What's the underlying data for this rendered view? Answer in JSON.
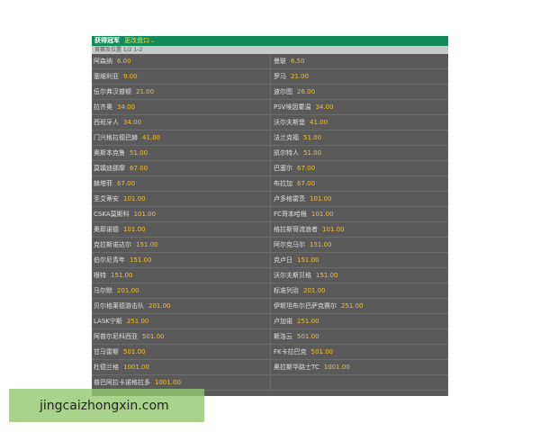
{
  "header": {
    "title": "获得冠军",
    "edit_label": "更改盘口",
    "chevron": "⌄"
  },
  "subheader": {
    "text": "首赛及位置 1/2 1-2"
  },
  "colors": {
    "header_bg": "#138a5c",
    "panel_bg": "#5a5a5a",
    "odds": "#f2c12e",
    "edit": "#ffdd33"
  },
  "rows": [
    [
      {
        "team": "阿森纳",
        "odds": "6.00"
      },
      {
        "team": "曼联",
        "odds": "6.50"
      }
    ],
    [
      {
        "team": "塞维利亚",
        "odds": "9.00"
      },
      {
        "team": "罗马",
        "odds": "21.00"
      }
    ],
    [
      {
        "team": "伍尔弗汉普顿",
        "odds": "21.00"
      },
      {
        "team": "波尔图",
        "odds": "26.00"
      }
    ],
    [
      {
        "team": "拉齐奥",
        "odds": "34.00"
      },
      {
        "team": "PSV埃因霍温",
        "odds": "34.00"
      }
    ],
    [
      {
        "team": "西班牙人",
        "odds": "34.00"
      },
      {
        "team": "沃尔夫斯堡",
        "odds": "41.00"
      }
    ],
    [
      {
        "team": "门兴格拉德巴赫",
        "odds": "41.00"
      },
      {
        "team": "法兰克福",
        "odds": "51.00"
      }
    ],
    [
      {
        "team": "奥斯本克鲁",
        "odds": "51.00"
      },
      {
        "team": "凯尔特人",
        "odds": "51.00"
      }
    ],
    [
      {
        "team": "莫镇迪那摩",
        "odds": "67.00"
      },
      {
        "team": "巴塞尔",
        "odds": "67.00"
      }
    ],
    [
      {
        "team": "赫塔菲",
        "odds": "67.00"
      },
      {
        "team": "布拉加",
        "odds": "67.00"
      }
    ],
    [
      {
        "team": "圣艾蒂安",
        "odds": "101.00"
      },
      {
        "team": "卢多格雷茨",
        "odds": "101.00"
      }
    ],
    [
      {
        "team": "CSKA莫斯科",
        "odds": "101.00"
      },
      {
        "team": "FC哥本哈根",
        "odds": "101.00"
      }
    ],
    [
      {
        "team": "奥耶诺德",
        "odds": "101.00"
      },
      {
        "team": "格拉斯哥流浪者",
        "odds": "101.00"
      }
    ],
    [
      {
        "team": "克拉斯诺达尔",
        "odds": "151.00"
      },
      {
        "team": "阿尔克马尔",
        "odds": "151.00"
      }
    ],
    [
      {
        "team": "伯尔尼青年",
        "odds": "151.00"
      },
      {
        "team": "克卢日",
        "odds": "151.00"
      }
    ],
    [
      {
        "team": "根特",
        "odds": "151.00"
      },
      {
        "team": "沃尔夫斯贝格",
        "odds": "151.00"
      }
    ],
    [
      {
        "team": "马尔默",
        "odds": "201.00"
      },
      {
        "team": "标准列治",
        "odds": "201.00"
      }
    ],
    [
      {
        "team": "贝尔格莱德游击队",
        "odds": "201.00"
      },
      {
        "team": "伊斯坦布尔巴萨克赛尔",
        "odds": "251.00"
      }
    ],
    [
      {
        "team": "LASK宁斯",
        "odds": "251.00"
      },
      {
        "team": "卢加诺",
        "odds": "251.00"
      }
    ],
    [
      {
        "team": "阿普尔尼科西亚",
        "odds": "501.00"
      },
      {
        "team": "斯洛云",
        "odds": "501.00"
      }
    ],
    [
      {
        "team": "甘马雷斯",
        "odds": "501.00"
      },
      {
        "team": "FK卡拉巴克",
        "odds": "501.00"
      }
    ],
    [
      {
        "team": "杜德兰格",
        "odds": "1001.00"
      },
      {
        "team": "奥拉斯华路士TC",
        "odds": "1001.00"
      }
    ],
    [
      {
        "team": "普巴阿拉卡诺格拉多",
        "odds": "1001.00"
      },
      {
        "team": "",
        "odds": ""
      }
    ]
  ],
  "watermark": {
    "text": "jingcaizhongxin.com"
  }
}
